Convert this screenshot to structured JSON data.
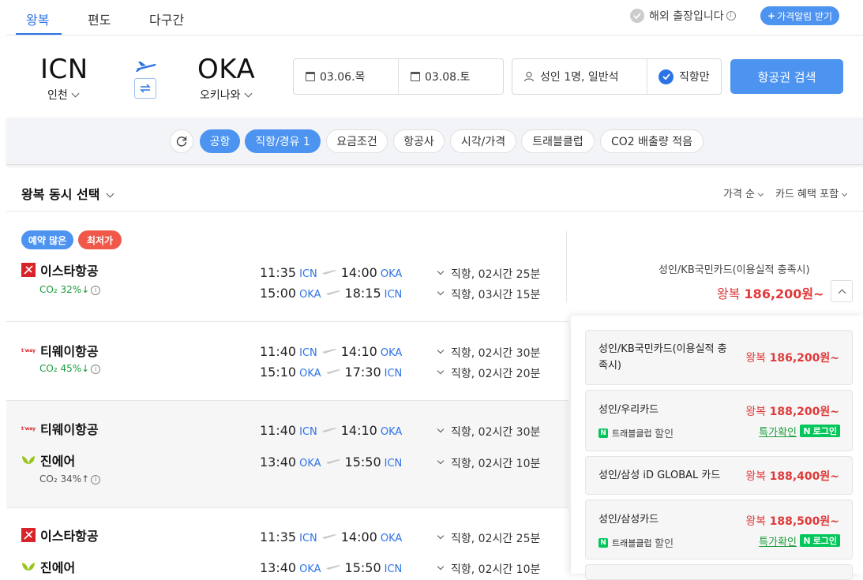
{
  "tabs": [
    {
      "label": "왕복"
    },
    {
      "label": "편도"
    },
    {
      "label": "다구간"
    }
  ],
  "top": {
    "overseas_trip": "해외 출장입니다",
    "alert_button": "가격알림 받기"
  },
  "route": {
    "from_code": "ICN",
    "from_city": "인천",
    "to_code": "OKA",
    "to_city": "오키나와"
  },
  "search": {
    "depart_date": "03.06.목",
    "return_date": "03.08.토",
    "passengers": "성인 1명, 일반석",
    "direct_only": "직항만",
    "search_button": "항공권 검색"
  },
  "filters": [
    "공항",
    "직항/경유 1",
    "요금조건",
    "항공사",
    "시각/가격",
    "트래블클럽",
    "CO2 배출량 적음"
  ],
  "results_header": {
    "title": "왕복 동시 선택",
    "sort": "가격 순",
    "card_benefit": "카드 혜택 포함"
  },
  "badges": {
    "popular": "예약 많은",
    "lowest": "최저가"
  },
  "results": [
    {
      "airline": "이스타항공",
      "co2": "CO₂ 32%↓",
      "out": {
        "dep": "11:35",
        "dep_ap": "ICN",
        "arr": "14:00",
        "arr_ap": "OKA",
        "dur": "직항, 02시간 25분"
      },
      "ret": {
        "dep": "15:00",
        "dep_ap": "OKA",
        "arr": "18:15",
        "arr_ap": "ICN",
        "dur": "직항, 03시간 15분"
      },
      "price_label": "성인/KB국민카드(이용실적 충족시)",
      "price_prefix": "왕복",
      "price": "186,200원~"
    },
    {
      "airline": "티웨이항공",
      "co2": "CO₂ 45%↓",
      "out": {
        "dep": "11:40",
        "dep_ap": "ICN",
        "arr": "14:10",
        "arr_ap": "OKA",
        "dur": "직항, 02시간 30분"
      },
      "ret": {
        "dep": "15:10",
        "dep_ap": "OKA",
        "arr": "17:30",
        "arr_ap": "ICN",
        "dur": "직항, 02시간 20분"
      }
    },
    {
      "airline": "티웨이항공",
      "out": {
        "dep": "11:40",
        "dep_ap": "ICN",
        "arr": "14:10",
        "arr_ap": "OKA",
        "dur": "직항, 02시간 30분"
      },
      "airline2": "진에어",
      "co2": "CO₂ 34%↑",
      "ret": {
        "dep": "13:40",
        "dep_ap": "OKA",
        "arr": "15:50",
        "arr_ap": "ICN",
        "dur": "직항, 02시간 10분"
      }
    },
    {
      "airline": "이스타항공",
      "out": {
        "dep": "11:35",
        "dep_ap": "ICN",
        "arr": "14:00",
        "arr_ap": "OKA",
        "dur": "직항, 02시간 25분"
      },
      "airline2": "진에어",
      "ret": {
        "dep": "13:40",
        "dep_ap": "OKA",
        "arr": "15:50",
        "arr_ap": "ICN",
        "dur": "직항, 02시간 10분"
      }
    }
  ],
  "card_prices": [
    {
      "name": "성인/KB국민카드(이용실적 충족시)",
      "prefix": "왕복",
      "price": "186,200원~"
    },
    {
      "name": "성인/우리카드",
      "prefix": "왕복",
      "price": "188,200원~",
      "club": "트래블클럽",
      "club_suffix": "할인",
      "check": "특가확인",
      "login": "로그인"
    },
    {
      "name": "성인/삼성 iD GLOBAL 카드",
      "prefix": "왕복",
      "price": "188,400원~"
    },
    {
      "name": "성인/삼성카드",
      "prefix": "왕복",
      "price": "188,500원~",
      "club": "트래블클럽",
      "club_suffix": "할인",
      "check": "특가확인",
      "login": "로그인"
    }
  ],
  "colors": {
    "accent": "#2d73e6",
    "button": "#4d93f0",
    "price_red": "#e03a3a",
    "co2_green": "#1a9d3c",
    "badge_lowest": "#f0584a",
    "naver": "#03c75a"
  }
}
